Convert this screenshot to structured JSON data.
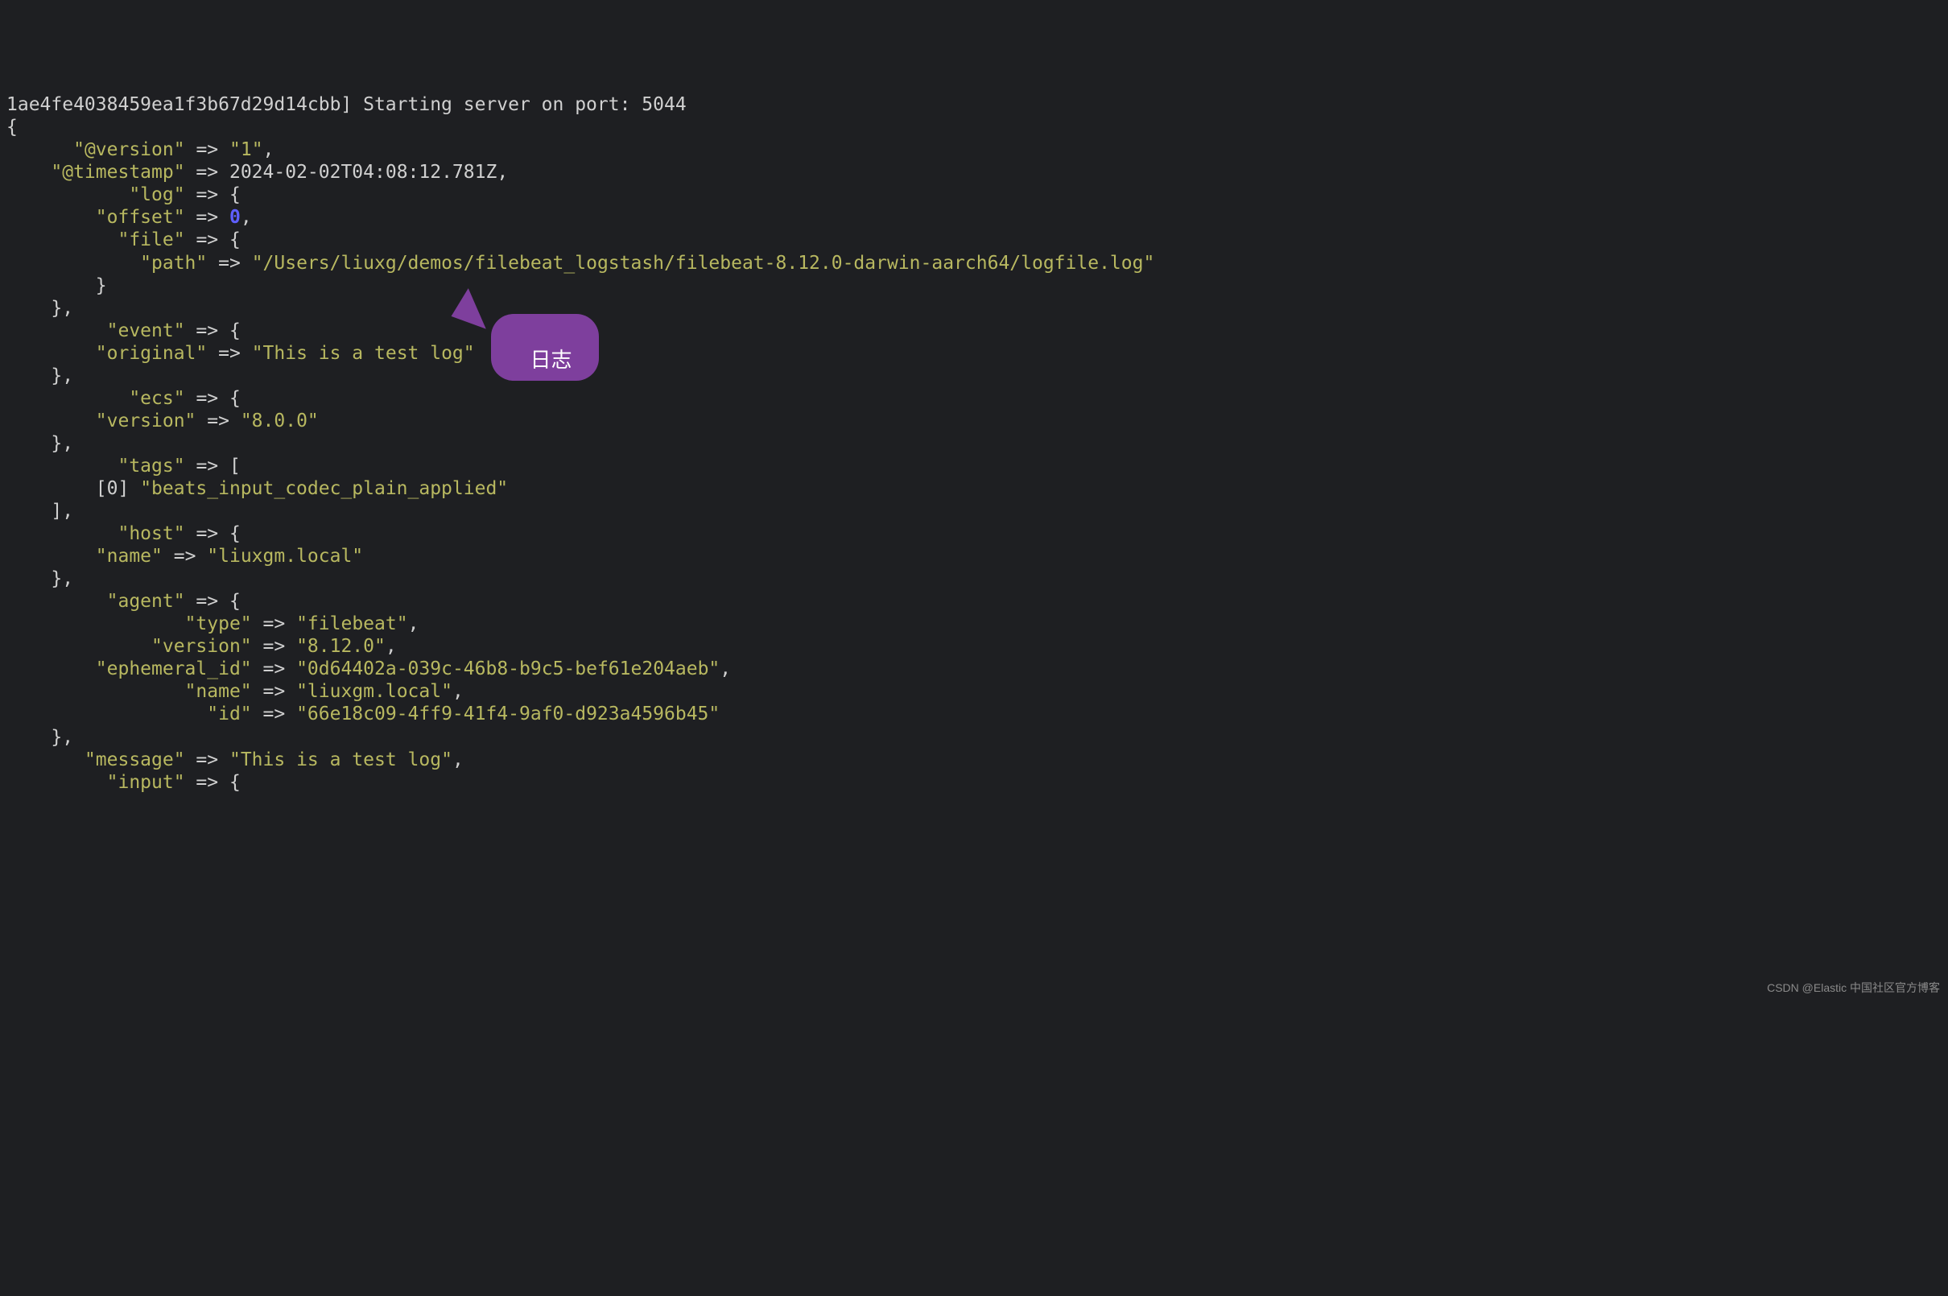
{
  "header_line": "1ae4fe4038459ea1f3b67d29d14cbb] Starting server on port: 5044",
  "record": {
    "version": "\"1\"",
    "timestamp": "2024-02-02T04:08:12.781Z",
    "log": {
      "offset": "0",
      "file": {
        "path": "\"/Users/liuxg/demos/filebeat_logstash/filebeat-8.12.0-darwin-aarch64/logfile.log\""
      }
    },
    "event": {
      "original": "\"This is a test log\""
    },
    "ecs": {
      "version": "\"8.0.0\""
    },
    "tags": {
      "index": "[0]",
      "value": "\"beats_input_codec_plain_applied\""
    },
    "host": {
      "name": "\"liuxgm.local\""
    },
    "agent": {
      "type": "\"filebeat\"",
      "version": "\"8.12.0\"",
      "ephemeral_id": "\"0d64402a-039c-46b8-b9c5-bef61e204aeb\"",
      "name": "\"liuxgm.local\"",
      "id": "\"66e18c09-4ff9-41f4-9af0-d923a4596b45\""
    },
    "message": "\"This is a test log\""
  },
  "keys": {
    "version": "\"@version\"",
    "timestamp": "\"@timestamp\"",
    "log": "\"log\"",
    "offset": "\"offset\"",
    "file": "\"file\"",
    "path": "\"path\"",
    "event": "\"event\"",
    "original": "\"original\"",
    "ecs": "\"ecs\"",
    "ecs_version": "\"version\"",
    "tags": "\"tags\"",
    "host": "\"host\"",
    "host_name": "\"name\"",
    "agent": "\"agent\"",
    "agent_type": "\"type\"",
    "agent_version": "\"version\"",
    "agent_ephemeral_id": "\"ephemeral_id\"",
    "agent_name": "\"name\"",
    "agent_id": "\"id\"",
    "message": "\"message\"",
    "input": "\"input\""
  },
  "arrow": "=>",
  "annotation_label": "日志",
  "watermark": "CSDN @Elastic 中国社区官方博客"
}
